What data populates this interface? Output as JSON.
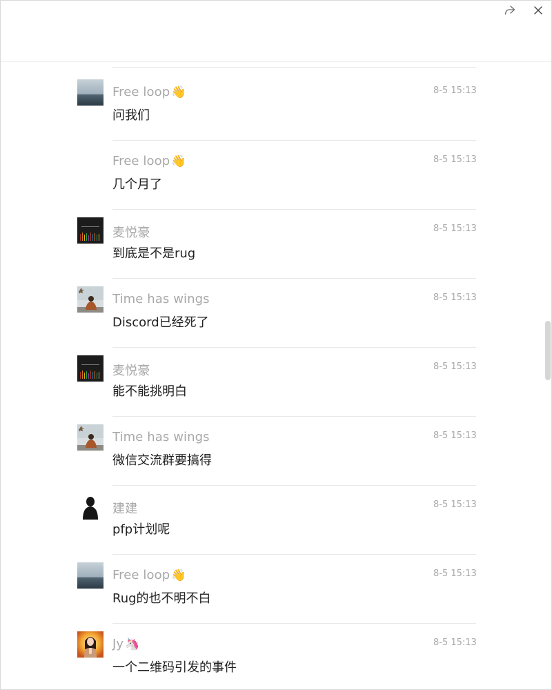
{
  "window": {
    "actions": [
      {
        "icon": "share-icon"
      },
      {
        "icon": "close-icon"
      }
    ]
  },
  "messages": [
    {
      "sender": "Free loop",
      "emoji": "👋",
      "time": "8-5 15:13",
      "text": "问我们",
      "avatar": "sea"
    },
    {
      "sender": "Free loop",
      "emoji": "👋",
      "time": "8-5 15:13",
      "text": "几个月了",
      "avatar": "none"
    },
    {
      "sender": "麦悦豪",
      "emoji": "",
      "time": "8-5 15:13",
      "text": "到底是不是rug",
      "avatar": "dark"
    },
    {
      "sender": "Time has wings",
      "emoji": "",
      "time": "8-5 15:13",
      "text": "Discord已经死了",
      "avatar": "person"
    },
    {
      "sender": "麦悦豪",
      "emoji": "",
      "time": "8-5 15:13",
      "text": "能不能挑明白",
      "avatar": "dark"
    },
    {
      "sender": "Time has wings",
      "emoji": "",
      "time": "8-5 15:13",
      "text": "微信交流群要搞得",
      "avatar": "person"
    },
    {
      "sender": "建建",
      "emoji": "",
      "time": "8-5 15:13",
      "text": "pfp计划呢",
      "avatar": "silhouette"
    },
    {
      "sender": "Free loop",
      "emoji": "👋",
      "time": "8-5 15:13",
      "text": "Rug的也不明不白",
      "avatar": "sea"
    },
    {
      "sender": "Jy",
      "emoji": "🦄",
      "time": "8-5 15:13",
      "text": "一个二维码引发的事件",
      "avatar": "girl"
    }
  ],
  "colors": {
    "name": "#a8a8a8",
    "time": "#a8a8a8",
    "text": "#222222",
    "divider": "#e8e8e8",
    "scrollbar": "#d6d6d6"
  }
}
